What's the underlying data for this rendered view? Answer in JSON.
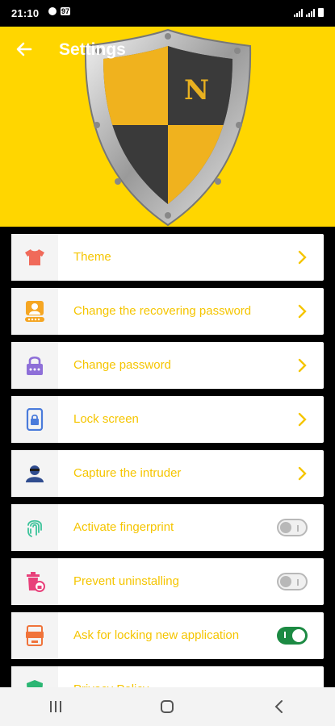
{
  "status_bar": {
    "time": "21:10",
    "notification_badge": "97"
  },
  "header": {
    "title": "Settings",
    "back_icon": "arrow-left-icon",
    "background_color": "#FFD600",
    "logo_letter": "N"
  },
  "settings": {
    "items": [
      {
        "label": "Theme",
        "icon": "tshirt-icon",
        "control": "chevron"
      },
      {
        "label": "Change the recovering password",
        "icon": "user-password-icon",
        "control": "chevron"
      },
      {
        "label": "Change password",
        "icon": "lock-icon",
        "control": "chevron"
      },
      {
        "label": "Lock screen",
        "icon": "phone-lock-icon",
        "control": "chevron"
      },
      {
        "label": "Capture the intruder",
        "icon": "intruder-icon",
        "control": "chevron"
      },
      {
        "label": "Activate fingerprint",
        "icon": "fingerprint-icon",
        "control": "toggle",
        "enabled": false
      },
      {
        "label": "Prevent uninstalling",
        "icon": "trash-lock-icon",
        "control": "toggle",
        "enabled": false
      },
      {
        "label": "Ask for locking new application",
        "icon": "app-lock-icon",
        "control": "toggle",
        "enabled": true
      },
      {
        "label": "Privacy Policy",
        "icon": "shield-icon",
        "control": "chevron"
      }
    ],
    "label_color": "#F5C500",
    "toggle_on_color": "#1C8A43"
  },
  "nav_bar": {
    "recents_icon": "recents-icon",
    "home_icon": "home-icon",
    "back_icon": "back-icon"
  }
}
